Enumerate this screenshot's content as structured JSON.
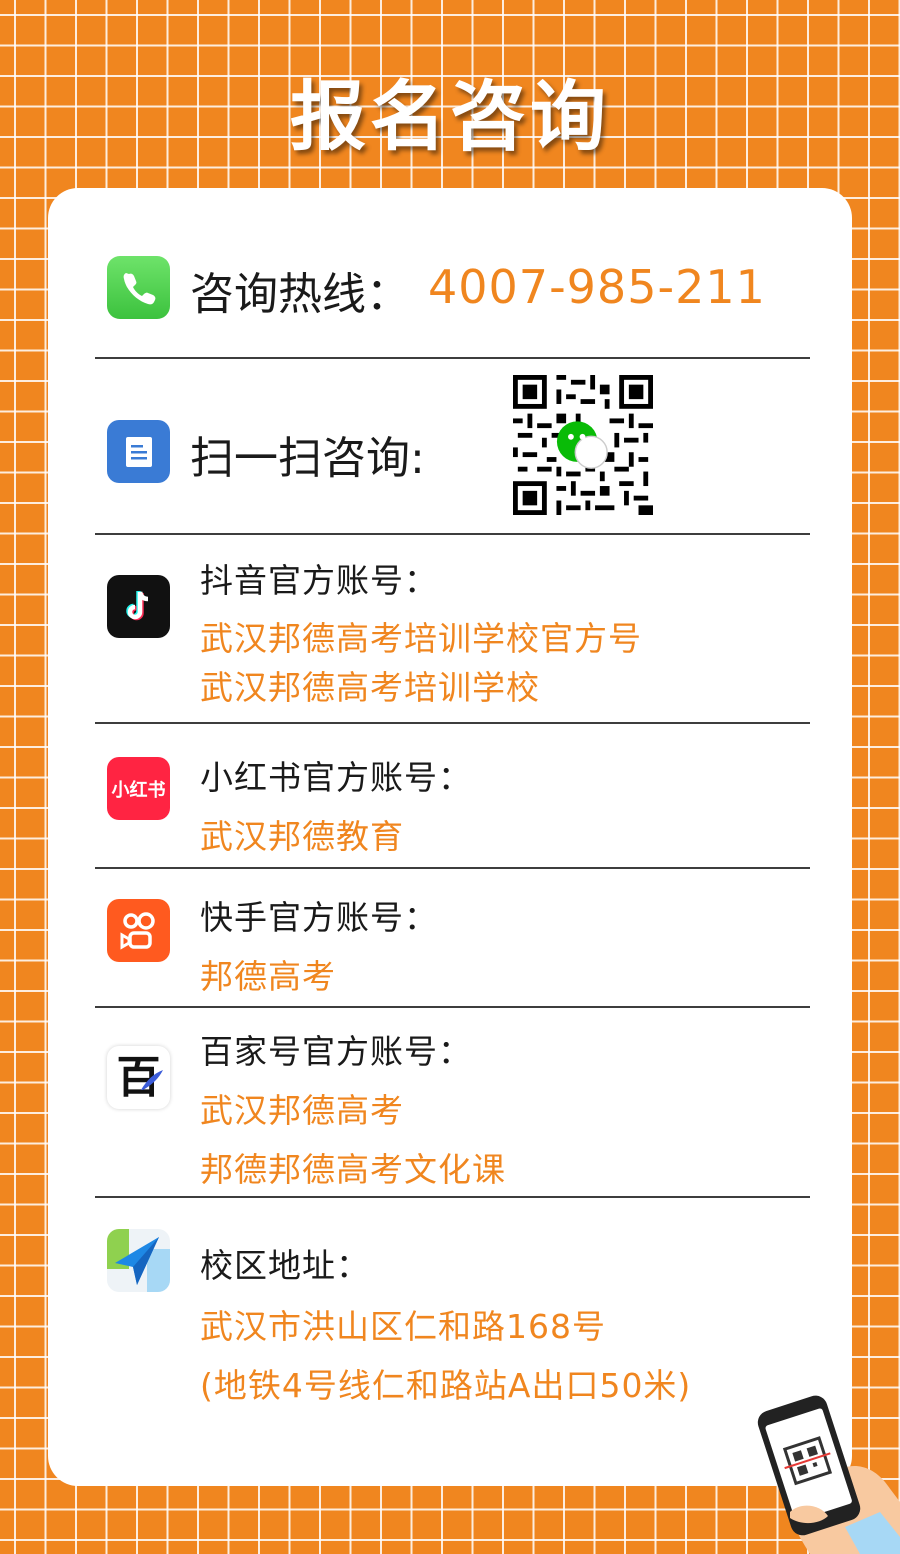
{
  "title": "报名咨询",
  "hotline": {
    "label": "咨询热线：",
    "number": "4007-985-211"
  },
  "scan": {
    "label": "扫一扫咨询:"
  },
  "douyin": {
    "label": "抖音官方账号：",
    "accounts": [
      "武汉邦德高考培训学校官方号",
      "武汉邦德高考培训学校"
    ]
  },
  "xiaohongshu": {
    "label": "小红书官方账号：",
    "icon_text": "小红书",
    "accounts": [
      "武汉邦德教育"
    ]
  },
  "kuaishou": {
    "label": "快手官方账号：",
    "accounts": [
      "邦德高考"
    ]
  },
  "baijiahao": {
    "label": "百家号官方账号：",
    "icon_text": "百",
    "accounts": [
      "武汉邦德高考",
      "邦德邦德高考文化课"
    ]
  },
  "address": {
    "label": "校区地址：",
    "lines": [
      "武汉市洪山区仁和路168号",
      "(地铁4号线仁和路站A出口50米)"
    ]
  },
  "colors": {
    "accent": "#f0861f",
    "text": "#1a1a1a",
    "card": "#ffffff",
    "phone_icon": "#4cd964",
    "doc_icon": "#3a7bd5",
    "xhs_icon": "#ff2442",
    "kuaishou_icon": "#ff5a1f"
  },
  "icons": [
    "phone-icon",
    "document-icon",
    "douyin-icon",
    "xiaohongshu-icon",
    "kuaishou-icon",
    "baijiahao-icon",
    "location-arrow-icon",
    "qr-code",
    "wechat-icon",
    "hand-phone-illustration"
  ]
}
